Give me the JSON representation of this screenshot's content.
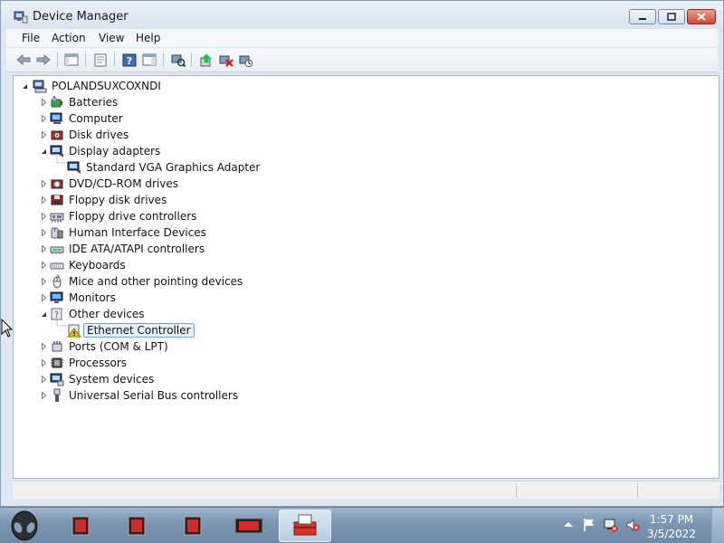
{
  "window": {
    "title": "Device Manager"
  },
  "menu": [
    "File",
    "Action",
    "View",
    "Help"
  ],
  "tree": {
    "root": "POLANDSUXCOXNDI",
    "items": [
      {
        "label": "Batteries",
        "icon": "battery-icon",
        "expanded": false
      },
      {
        "label": "Computer",
        "icon": "computer-icon",
        "expanded": false
      },
      {
        "label": "Disk drives",
        "icon": "disk-drive-icon",
        "expanded": false
      },
      {
        "label": "Display adapters",
        "icon": "display-adapter-icon",
        "expanded": true,
        "children": [
          {
            "label": "Standard VGA Graphics Adapter",
            "icon": "display-adapter-icon"
          }
        ]
      },
      {
        "label": "DVD/CD-ROM drives",
        "icon": "dvd-drive-icon",
        "expanded": false
      },
      {
        "label": "Floppy disk drives",
        "icon": "floppy-disk-icon",
        "expanded": false
      },
      {
        "label": "Floppy drive controllers",
        "icon": "floppy-controller-icon",
        "expanded": false
      },
      {
        "label": "Human Interface Devices",
        "icon": "hid-icon",
        "expanded": false
      },
      {
        "label": "IDE ATA/ATAPI controllers",
        "icon": "ide-controller-icon",
        "expanded": false
      },
      {
        "label": "Keyboards",
        "icon": "keyboard-icon",
        "expanded": false
      },
      {
        "label": "Mice and other pointing devices",
        "icon": "mouse-icon",
        "expanded": false
      },
      {
        "label": "Monitors",
        "icon": "monitor-icon",
        "expanded": false
      },
      {
        "label": "Other devices",
        "icon": "unknown-device-icon",
        "expanded": true,
        "children": [
          {
            "label": "Ethernet Controller",
            "icon": "warning-device-icon",
            "selected": true
          }
        ]
      },
      {
        "label": "Ports (COM & LPT)",
        "icon": "port-icon",
        "expanded": false
      },
      {
        "label": "Processors",
        "icon": "processor-icon",
        "expanded": false
      },
      {
        "label": "System devices",
        "icon": "system-device-icon",
        "expanded": false
      },
      {
        "label": "Universal Serial Bus controllers",
        "icon": "usb-icon",
        "expanded": false
      }
    ]
  },
  "taskbar": {
    "time": "1:57 PM",
    "date": "3/5/2022"
  },
  "colors": {
    "selection": "#e5f1fb",
    "selection_border": "#7da2ce",
    "warning": "#f2c200"
  }
}
